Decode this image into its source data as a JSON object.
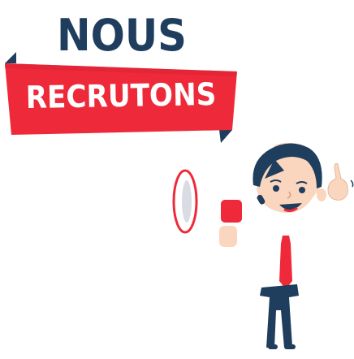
{
  "headline": {
    "line1": "NOUS",
    "line2": "RECRUTONS"
  },
  "colors": {
    "navy": "#1f3d5c",
    "red": "#ee2a3a",
    "dark_red": "#9c1422",
    "skin": "#fbd6bf",
    "white": "#ffffff"
  },
  "illustration": {
    "icon_names": [
      "megaphone-icon",
      "businessman-figure",
      "pointing-hand-icon",
      "red-tie-icon"
    ]
  }
}
